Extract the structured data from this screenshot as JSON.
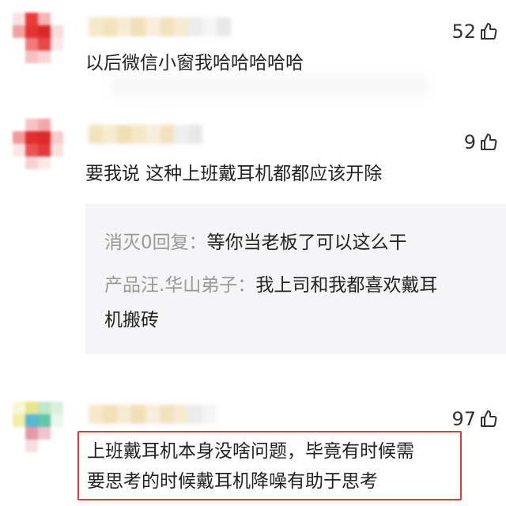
{
  "comments": [
    {
      "likes": "52",
      "text": "以后微信小窗我哈哈哈哈哈"
    },
    {
      "likes": "9",
      "text": "要我说 这种上班戴耳机都都应该开除",
      "replies": [
        {
          "author": "消灭0回复",
          "sep": "：",
          "text": "等你当老板了可以这么干"
        },
        {
          "author": "产品汪.华山弟子",
          "sep": "：",
          "text_line1": "我上司和我都喜欢戴耳",
          "text_line2": "机搬砖"
        }
      ]
    },
    {
      "likes": "97",
      "text_line1": "上班戴耳机本身没啥问题，毕竟有时候需",
      "text_line2": "要思考的时候戴耳机降噪有助于思考"
    }
  ],
  "colors": {
    "highlight_border": "#e23a3a",
    "reply_background": "#f5f5f7",
    "reply_author": "#999999"
  },
  "icons": {
    "like": "thumbs-up-icon"
  }
}
